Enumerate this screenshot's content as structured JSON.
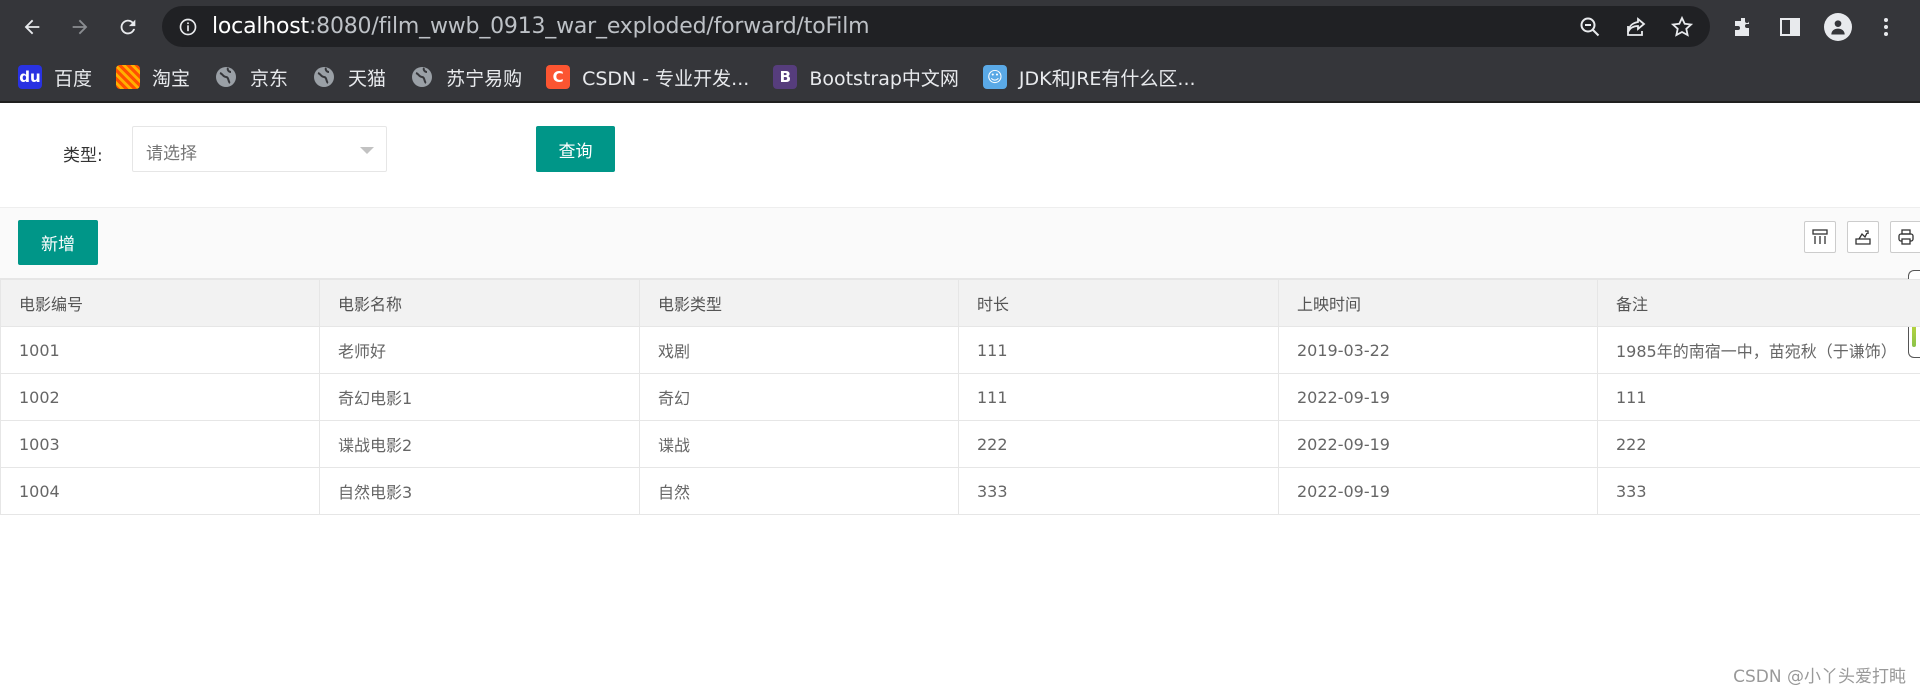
{
  "browser": {
    "url_host": "localhost",
    "url_rest": ":8080/film_wwb_0913_war_exploded/forward/toFilm",
    "bookmarks": [
      {
        "label": "百度",
        "icon": "baidu-icon",
        "color": "#2932e1"
      },
      {
        "label": "淘宝",
        "icon": "taobao-icon",
        "color": "#ff5000"
      },
      {
        "label": "京东",
        "icon": "globe-icon",
        "color": "#9aa0a6"
      },
      {
        "label": "天猫",
        "icon": "globe-icon",
        "color": "#9aa0a6"
      },
      {
        "label": "苏宁易购",
        "icon": "globe-icon",
        "color": "#9aa0a6"
      },
      {
        "label": "CSDN - 专业开发...",
        "icon": "csdn-icon",
        "color": "#fc5531"
      },
      {
        "label": "Bootstrap中文网",
        "icon": "bootstrap-icon",
        "color": "#563d7c"
      },
      {
        "label": "JDK和JRE有什么区...",
        "icon": "avatar-icon",
        "color": "#5aa9e6"
      }
    ]
  },
  "filter": {
    "type_label": "类型:",
    "select_placeholder": "请选择",
    "query_label": "查询"
  },
  "toolbar": {
    "add_label": "新增"
  },
  "table": {
    "headers": [
      "电影编号",
      "电影名称",
      "电影类型",
      "时长",
      "上映时间",
      "备注"
    ],
    "rows": [
      [
        "1001",
        "老师好",
        "戏剧",
        "111",
        "2019-03-22",
        "1985年的南宿一中，苗宛秋（于谦饰）"
      ],
      [
        "1002",
        "奇幻电影1",
        "奇幻",
        "111",
        "2022-09-19",
        "111"
      ],
      [
        "1003",
        "谍战电影2",
        "谍战",
        "222",
        "2022-09-19",
        "222"
      ],
      [
        "1004",
        "自然电影3",
        "自然",
        "333",
        "2022-09-19",
        "333"
      ]
    ]
  },
  "watermark": "CSDN @小丫头爱打盹",
  "colors": {
    "primary": "#009688",
    "chrome": "#35363a",
    "omnibox": "#202124"
  }
}
